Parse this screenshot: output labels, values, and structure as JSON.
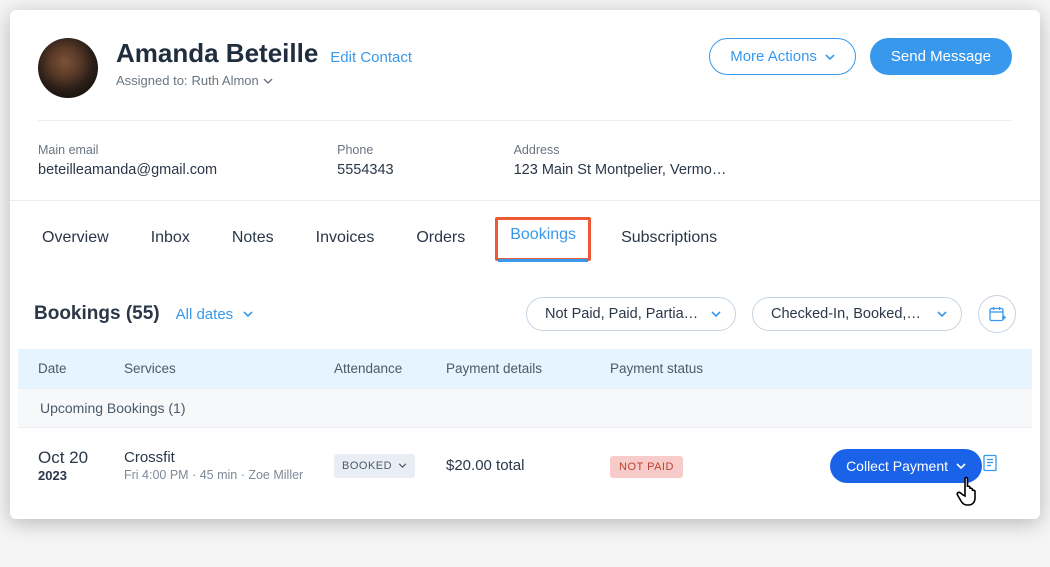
{
  "header": {
    "name": "Amanda Beteille",
    "edit_link": "Edit Contact",
    "assigned_prefix": "Assigned to:",
    "assigned_name": "Ruth Almon",
    "more_actions": "More Actions",
    "send_message": "Send Message"
  },
  "fields": {
    "email_label": "Main email",
    "email_value": "beteilleamanda@gmail.com",
    "phone_label": "Phone",
    "phone_value": "5554343",
    "address_label": "Address",
    "address_value": "123 Main St Montpelier, Vermo…"
  },
  "tabs": {
    "overview": "Overview",
    "inbox": "Inbox",
    "notes": "Notes",
    "invoices": "Invoices",
    "orders": "Orders",
    "bookings": "Bookings",
    "subscriptions": "Subscriptions"
  },
  "bookings": {
    "title": "Bookings (55)",
    "dates_filter": "All dates",
    "status_filter": "Not Paid, Paid, Partia…",
    "state_filter": "Checked-In, Booked,…",
    "columns": {
      "date": "Date",
      "services": "Services",
      "attendance": "Attendance",
      "payment_details": "Payment details",
      "payment_status": "Payment status"
    },
    "section_label": "Upcoming Bookings (1)",
    "row": {
      "date_main": "Oct 20",
      "date_year": "2023",
      "service": "Crossfit",
      "service_sub": "Fri 4:00 PM · 45 min · Zoe Miller",
      "attendance_pill": "BOOKED",
      "amount": "$20.00 total",
      "status_badge": "NOT PAID",
      "collect_button": "Collect Payment"
    }
  }
}
